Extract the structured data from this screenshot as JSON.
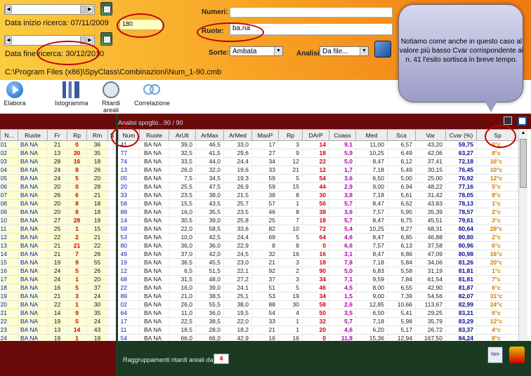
{
  "top": {
    "start_label": "Data inizio ricerca: 07/11/2009",
    "end_label": "Data fine ricerca: 30/12/2010",
    "count_value": "180",
    "path": "C:\\Program Files (x86)\\SpyClass\\Combinazioni\\Num_1-90.cmb",
    "numeri_label": "Numeri:",
    "numeri_value": "",
    "ruote_label": "Ruote:",
    "ruote_value": "ba.na",
    "sorte_label": "Sorte:",
    "sorte_value": "Ambata",
    "analisi_label": "Analisi:",
    "analisi_value": "Da file..."
  },
  "toolbar": {
    "elabora": "Elabora",
    "istogramma": "Istogramma",
    "ritardi": "Ritardi areali",
    "correlazione": "Correlazione"
  },
  "note": {
    "text": "Notiamo come anche in questo caso al valore più basso Cvar corrispondente al n. 41 l'esito sortisca in breve tempo."
  },
  "analysis_title": "Analisi spoglio...90 / 90",
  "left_table": {
    "columns": [
      "N...",
      "Ruote",
      "Fr",
      "Rp",
      "Rm",
      "S"
    ],
    "rows": [
      [
        "01",
        "BA NA",
        "21",
        "0",
        "36"
      ],
      [
        "02",
        "BA NA",
        "13",
        "30",
        "35"
      ],
      [
        "03",
        "BA NA",
        "28",
        "16",
        "18"
      ],
      [
        "04",
        "BA NA",
        "24",
        "8",
        "26"
      ],
      [
        "05",
        "BA NA",
        "24",
        "5",
        "20"
      ],
      [
        "06",
        "BA NA",
        "20",
        "0",
        "28"
      ],
      [
        "07",
        "BA NA",
        "26",
        "6",
        "21"
      ],
      [
        "08",
        "BA NA",
        "20",
        "8",
        "18"
      ],
      [
        "09",
        "BA NA",
        "20",
        "8",
        "18"
      ],
      [
        "10",
        "BA NA",
        "27",
        "28",
        "19"
      ],
      [
        "11",
        "BA NA",
        "25",
        "1",
        "15"
      ],
      [
        "12",
        "BA NA",
        "22",
        "2",
        "21"
      ],
      [
        "13",
        "BA NA",
        "21",
        "21",
        "22"
      ],
      [
        "14",
        "BA NA",
        "21",
        "7",
        "26"
      ],
      [
        "15",
        "BA NA",
        "19",
        "9",
        "55"
      ],
      [
        "16",
        "BA NA",
        "24",
        "5",
        "26"
      ],
      [
        "17",
        "BA NA",
        "24",
        "1",
        "20"
      ],
      [
        "18",
        "BA NA",
        "16",
        "5",
        "37"
      ],
      [
        "19",
        "BA NA",
        "21",
        "3",
        "24"
      ],
      [
        "20",
        "BA NA",
        "22",
        "1",
        "30"
      ],
      [
        "21",
        "BA NA",
        "14",
        "9",
        "35"
      ],
      [
        "22",
        "BA NA",
        "19",
        "5",
        "24"
      ],
      [
        "23",
        "BA NA",
        "13",
        "14",
        "43"
      ],
      [
        "24",
        "BA NA",
        "19",
        "1",
        "19"
      ]
    ]
  },
  "right_table": {
    "columns": [
      "Num",
      "Ruote",
      "ArUlt",
      "ArMax",
      "ArMed",
      "MaxP",
      "Rp",
      "DArP",
      "Coass",
      "Med",
      "Sca",
      "Var",
      "Cvar (%)",
      "Sp"
    ],
    "rows": [
      [
        "41",
        "BA NA",
        "39,0",
        "46,5",
        "33,0",
        "17",
        "3",
        "14",
        "9,1",
        "11,00",
        "6,57",
        "43,20",
        "59,75",
        "6°c"
      ],
      [
        "77",
        "BA NA",
        "32,5",
        "41,5",
        "29,6",
        "27",
        "9",
        "18",
        "5,9",
        "10,25",
        "6,49",
        "42,06",
        "63,27",
        "8°c"
      ],
      [
        "74",
        "BA NA",
        "33,5",
        "44,0",
        "24,4",
        "34",
        "12",
        "22",
        "5,0",
        "8,47",
        "6,12",
        "37,41",
        "72,18",
        "16°c"
      ],
      [
        "13",
        "BA NA",
        "26,0",
        "32,0",
        "19,6",
        "33",
        "21",
        "12",
        "1,7",
        "7,18",
        "5,49",
        "30,15",
        "76,45",
        "10°c"
      ],
      [
        "05",
        "BA NA",
        "7,5",
        "34,5",
        "19,3",
        "59",
        "5",
        "54",
        "3,6",
        "6,50",
        "5,00",
        "25,00",
        "76,92",
        "12°c"
      ],
      [
        "20",
        "BA NA",
        "25,5",
        "47,5",
        "26,9",
        "59",
        "15",
        "44",
        "2,9",
        "9,00",
        "6,94",
        "48,22",
        "77,16",
        "5°c"
      ],
      [
        "33",
        "BA NA",
        "23,5",
        "38,0",
        "21,5",
        "38",
        "8",
        "30",
        "3,8",
        "7,18",
        "5,61",
        "31,42",
        "78,05",
        "8°c"
      ],
      [
        "58",
        "BA NA",
        "15,5",
        "43,5",
        "25,7",
        "57",
        "1",
        "56",
        "5,7",
        "8,47",
        "6,62",
        "43,83",
        "78,13",
        "1°c"
      ],
      [
        "89",
        "BA NA",
        "16,0",
        "35,5",
        "23,5",
        "46",
        "8",
        "38",
        "3,6",
        "7,57",
        "5,95",
        "35,39",
        "78,57",
        "2°c"
      ],
      [
        "14",
        "BA NA",
        "30,5",
        "39,0",
        "25,8",
        "25",
        "7",
        "18",
        "5,7",
        "8,47",
        "6,75",
        "45,51",
        "79,61",
        "3°c"
      ],
      [
        "59",
        "BA NA",
        "22,0",
        "58,5",
        "33,6",
        "82",
        "10",
        "72",
        "5,4",
        "10,25",
        "8,27",
        "68,31",
        "80,64",
        "28°c"
      ],
      [
        "53",
        "BA NA",
        "10,0",
        "42,5",
        "24,4",
        "69",
        "5",
        "64",
        "4,6",
        "8,47",
        "6,85",
        "46,88",
        "80,80",
        "2°c"
      ],
      [
        "80",
        "BA NA",
        "36,0",
        "36,0",
        "22,9",
        "8",
        "8",
        "0",
        "6,6",
        "7,57",
        "6,13",
        "37,58",
        "80,96",
        "6°c"
      ],
      [
        "49",
        "BA NA",
        "37,0",
        "42,0",
        "24,5",
        "32",
        "16",
        "16",
        "3,1",
        "8,47",
        "6,86",
        "47,09",
        "80,98",
        "16°c"
      ],
      [
        "19",
        "BA NA",
        "36,5",
        "45,5",
        "23,0",
        "21",
        "3",
        "18",
        "7,8",
        "7,18",
        "5,84",
        "34,06",
        "81,26",
        "20°c"
      ],
      [
        "12",
        "BA NA",
        "6,5",
        "51,5",
        "22,1",
        "92",
        "2",
        "90",
        "5,0",
        "6,83",
        "5,58",
        "31,19",
        "81,81",
        "1°c"
      ],
      [
        "68",
        "BA NA",
        "31,5",
        "48,0",
        "27,2",
        "37",
        "3",
        "34",
        "7,1",
        "9,59",
        "7,84",
        "61,54",
        "81,81",
        "7°c"
      ],
      [
        "22",
        "BA NA",
        "16,0",
        "39,0",
        "24,1",
        "51",
        "5",
        "46",
        "4,5",
        "8,00",
        "6,55",
        "42,90",
        "81,87",
        "6°c"
      ],
      [
        "89",
        "BA NA",
        "21,0",
        "38,5",
        "25,1",
        "53",
        "19",
        "34",
        "1,5",
        "9,00",
        "7,39",
        "54,56",
        "82,07",
        "31°c"
      ],
      [
        "02",
        "BA NA",
        "26,0",
        "55,5",
        "38,0",
        "88",
        "30",
        "58",
        "2,6",
        "12,85",
        "10,66",
        "113,67",
        "82,99",
        "24°c"
      ],
      [
        "64",
        "BA NA",
        "11,0",
        "36,0",
        "19,5",
        "54",
        "4",
        "50",
        "3,5",
        "6,50",
        "5,41",
        "29,25",
        "83,21",
        "6°c"
      ],
      [
        "17",
        "BA NA",
        "22,5",
        "38,5",
        "22,0",
        "33",
        "1",
        "32",
        "5,7",
        "7,18",
        "5,98",
        "35,79",
        "83,29",
        "12°c"
      ],
      [
        "11",
        "BA NA",
        "18,5",
        "28,0",
        "18,2",
        "21",
        "1",
        "20",
        "4,6",
        "6,20",
        "5,17",
        "26,72",
        "83,37",
        "4°c"
      ],
      [
        "54",
        "BA NA",
        "66,0",
        "66,0",
        "42,9",
        "16",
        "16",
        "0",
        "11,8",
        "15,36",
        "12,94",
        "167,50",
        "84,24",
        "8°c"
      ]
    ]
  },
  "bottom": {
    "label": "Raggruppamenti ritardi areali da",
    "value": "4"
  }
}
